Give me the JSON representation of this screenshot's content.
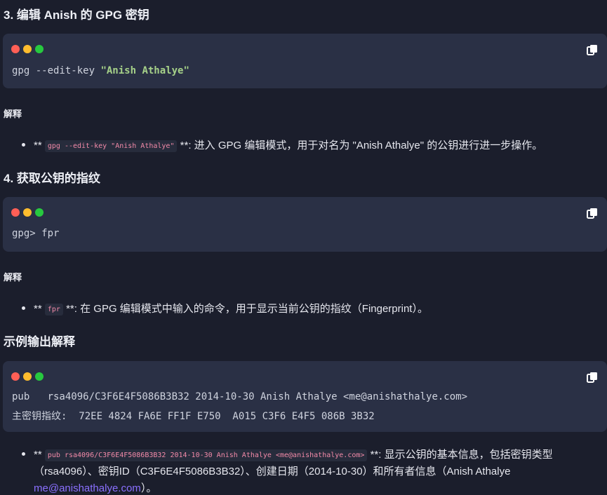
{
  "section3": {
    "heading": "3. 编辑 Anish 的 GPG 密钥",
    "code_cmd": "gpg --edit-key ",
    "code_str": "\"Anish Athalye\"",
    "explain_label": "解释",
    "bullet_prefix": "**",
    "bullet_code": "gpg --edit-key \"Anish Athalye\"",
    "bullet_text": "**: 进入 GPG 编辑模式，用于对名为 \"Anish Athalye\" 的公钥进行进一步操作。"
  },
  "section4": {
    "heading": "4. 获取公钥的指纹",
    "code_line": "gpg> fpr",
    "explain_label": "解释",
    "bullet_prefix": "**",
    "bullet_code": "fpr",
    "bullet_text": "**: 在 GPG 编辑模式中输入的命令，用于显示当前公钥的指纹（Fingerprint）。"
  },
  "section5": {
    "heading": "示例输出解释",
    "code_line1": "pub   rsa4096/C3F6E4F5086B3B32 2014-10-30 Anish Athalye <me@anishathalye.com>",
    "code_line2": "主密钥指纹:  72EE 4824 FA6E FF1F E750  A015 C3F6 E4F5 086B 3B32",
    "bullet_prefix": "**",
    "bullet_code": "pub rsa4096/C3F6E4F5086B3B32 2014-10-30 Anish Athalye <me@anishathalye.com>",
    "bullet_text1": "**: 显示公钥的基本信息，包括密钥类型",
    "bullet_text2": "（rsa4096）、密钥ID（C3F6E4F5086B3B32）、创建日期（2014-10-30）和所有者信息（Anish Athalye",
    "bullet_link": "me@anishathalye.com",
    "bullet_tail": "）。"
  },
  "colors": {
    "background": "#1b1e2c",
    "code_bg": "#2a3045",
    "string": "#a6d189",
    "inline_code": "#f28aa8",
    "link": "#8a70ff"
  },
  "icons": [
    "copy-icon"
  ]
}
